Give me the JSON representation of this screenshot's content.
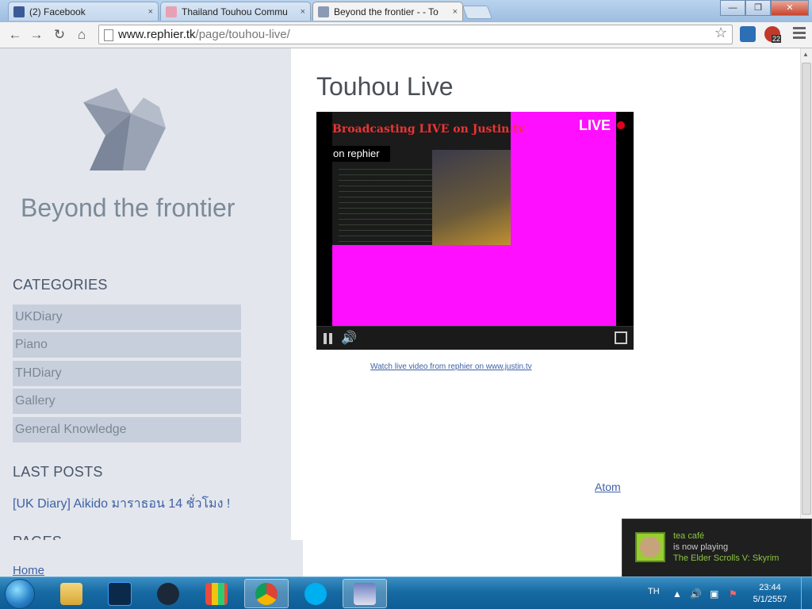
{
  "browser": {
    "tabs": [
      {
        "label": "(2) Facebook",
        "icon_color": "#3b5998"
      },
      {
        "label": "Thailand Touhou Commu",
        "icon_color": "#e8a0b4"
      },
      {
        "label": "Beyond the frontier - - To",
        "icon_color": "#8a9ab5"
      }
    ],
    "close_glyph": "×",
    "window_buttons": {
      "minimize": "—",
      "maximize": "❐",
      "close": "✕"
    },
    "url_domain": "www.rephier.tk",
    "url_path": "/page/touhou-live/",
    "extension_badge": "22"
  },
  "sidebar": {
    "site_title": "Beyond the frontier",
    "categories_heading": "CATEGORIES",
    "categories": [
      "UKDiary",
      "Piano",
      "THDiary",
      "Gallery",
      "General Knowledge"
    ],
    "last_posts_heading": "LAST POSTS",
    "last_post": "[UK Diary] Aikido มาราธอน 14 ชั่วโมง !",
    "pages_heading": "PAGES",
    "page_link": "Home"
  },
  "main": {
    "title": "Touhou Live",
    "player": {
      "broadcast_text": "Broadcasting LIVE on Justin.tv",
      "on_text": "on rephier",
      "live_label": "LIVE"
    },
    "watch_link": "Watch live video from rephier on www.justin.tv",
    "atom_link": "Atom"
  },
  "notification": {
    "name": "tea café",
    "status": "is now playing",
    "game": "The Elder Scrolls V: Skyrim"
  },
  "taskbar": {
    "language": "TH",
    "time": "23:44",
    "date": "5/1/2557"
  },
  "colors": {
    "sidebar_bg": "#e3e6ec",
    "category_bg": "#c8cfdc",
    "link": "#3d62a5",
    "player_magenta": "#ff0fff"
  }
}
